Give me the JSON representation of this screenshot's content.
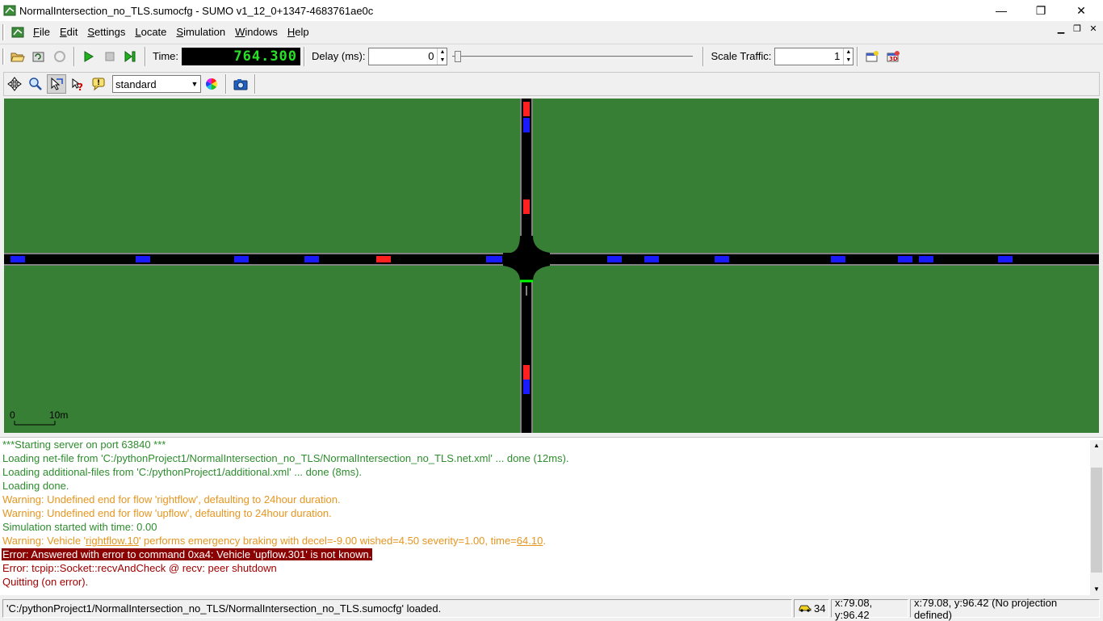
{
  "window": {
    "title": "NormalIntersection_no_TLS.sumocfg - SUMO v1_12_0+1347-4683761ae0c",
    "minimize": "—",
    "maximize": "❐",
    "close": "✕"
  },
  "menu": {
    "items": [
      {
        "label": "File",
        "accel": "F",
        "rest": "ile"
      },
      {
        "label": "Edit",
        "accel": "E",
        "rest": "dit"
      },
      {
        "label": "Settings",
        "accel": "S",
        "rest": "ettings"
      },
      {
        "label": "Locate",
        "accel": "L",
        "rest": "ocate"
      },
      {
        "label": "Simulation",
        "accel": "S",
        "rest": "imulation"
      },
      {
        "label": "Windows",
        "accel": "W",
        "rest": "indows"
      },
      {
        "label": "Help",
        "accel": "H",
        "rest": "elp"
      }
    ]
  },
  "toolbar": {
    "time_label": "Time:",
    "time_value": "764.300",
    "delay_label": "Delay (ms):",
    "delay_value": "0",
    "delay_slider_fraction": 0,
    "scale_label": "Scale Traffic:",
    "scale_value": "1"
  },
  "view_toolbar": {
    "scheme_value": "standard"
  },
  "view": {
    "scale_zero": "0",
    "scale_len": "10m",
    "colors": {
      "grass": "#367f34",
      "road": "#000000",
      "blue_vehicle": "#1a1aff",
      "red_vehicle": "#ff2020",
      "green_stopline": "#00ff00"
    }
  },
  "log": {
    "lines": [
      {
        "cls": "ok",
        "text": "***Starting server on port 63840 ***"
      },
      {
        "cls": "ok",
        "text": "Loading net-file from 'C:/pythonProject1/NormalIntersection_no_TLS/NormalIntersection_no_TLS.net.xml' ... done (12ms)."
      },
      {
        "cls": "ok",
        "text": "Loading additional-files from 'C:/pythonProject1/additional.xml' ... done (8ms)."
      },
      {
        "cls": "ok",
        "text": "Loading done."
      },
      {
        "cls": "warn",
        "text": "Warning: Undefined end for flow 'rightflow', defaulting to 24hour duration."
      },
      {
        "cls": "warn",
        "text": "Warning: Undefined end for flow 'upflow', defaulting to 24hour duration."
      },
      {
        "cls": "ok",
        "text": "Simulation started with time: 0.00"
      },
      {
        "cls": "err",
        "text": "Error: tcpip::Socket::recvAndCheck @ recv: peer shutdown"
      },
      {
        "cls": "err",
        "text": "Quitting (on error)."
      }
    ],
    "emergency": {
      "pre": "Warning: Vehicle '",
      "vehicle": "rightflow.10",
      "mid": "' performs emergency braking with decel=-9.00 wished=4.50 severity=1.00, time=",
      "time": "64.10",
      "post": "."
    },
    "selected_error": "Error: Answered with error to command 0xa4: Vehicle 'upflow.301' is not known."
  },
  "status": {
    "message": "'C:/pythonProject1/NormalIntersection_no_TLS/NormalIntersection_no_TLS.sumocfg' loaded.",
    "vehicle_count": "34",
    "coords": "x:79.08, y:96.42",
    "coords_proj": "x:79.08, y:96.42 (No projection defined)"
  }
}
